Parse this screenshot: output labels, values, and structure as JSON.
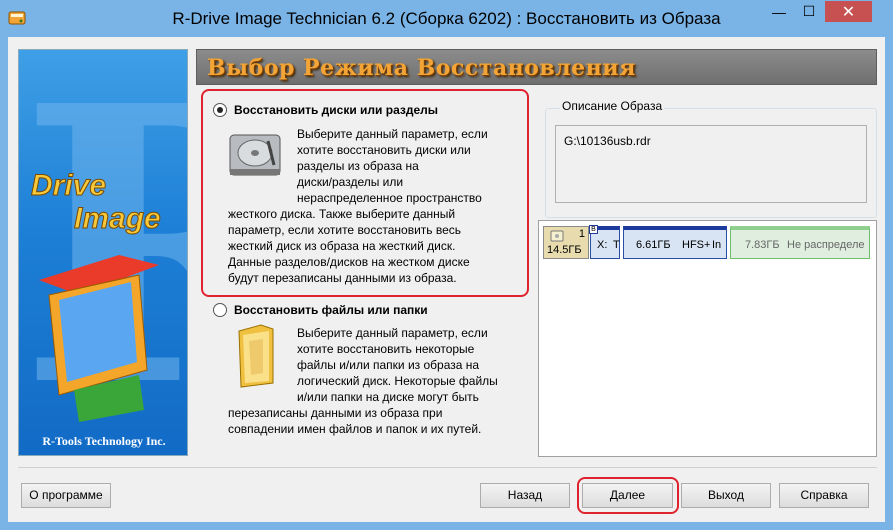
{
  "window": {
    "title": "R-Drive Image Technician 6.2 (Сборка 6202) : Восстановить из Образа",
    "minimize_glyph": "—",
    "maximize_glyph": "☐",
    "close_glyph": "✕"
  },
  "banner": {
    "logo_r": "R",
    "logo_drive": "Drive",
    "logo_image": "Image",
    "footer": "R-Tools Technology Inc."
  },
  "header": {
    "title": "Выбор Режима Восстановления"
  },
  "options": [
    {
      "title": "Восстановить диски или разделы",
      "checked": true,
      "description_lines": [
        "Выберите данный параметр, если",
        "хотите восстановить диски или",
        "разделы из образа на",
        "диски/разделы или",
        "нераспределенное пространство",
        "жесткого диска. Также выберите данный",
        "параметр, если хотите восстановить весь",
        "жесткий диск из образа на жесткий диск.",
        "Данные разделов/дисков на жестком диске",
        "будут перезаписаны данными из образа."
      ]
    },
    {
      "title": "Восстановить файлы или папки",
      "checked": false,
      "description_lines": [
        "Выберите данный параметр, если",
        "хотите восстановить некоторые",
        "файлы и/или папки из образа на",
        "логический диск. Некоторые файлы",
        "и/или папки на диске могут быть",
        "перезаписаны данными из образа при",
        "совпадении имен файлов и папок и их путей."
      ]
    }
  ],
  "image_description": {
    "legend": "Описание Образа",
    "text": "G:\\10136usb.rdr"
  },
  "disk_map": {
    "disk_number": "1",
    "disk_size": "14.5ГБ",
    "partitions": [
      {
        "label": "X:",
        "extra": "T",
        "flag": "B",
        "badge": "B"
      },
      {
        "size": "6.61ГБ",
        "fs": "HFS+",
        "extra": "In"
      },
      {
        "size": "7.83ГБ",
        "label": "Не распределе"
      }
    ]
  },
  "buttons": {
    "about": "О программе",
    "back": "Назад",
    "next": "Далее",
    "exit": "Выход",
    "help": "Справка"
  },
  "colors": {
    "titlebar": "#7ab4e6",
    "highlight_red": "#e0242f",
    "header_text": "#f2a437"
  }
}
